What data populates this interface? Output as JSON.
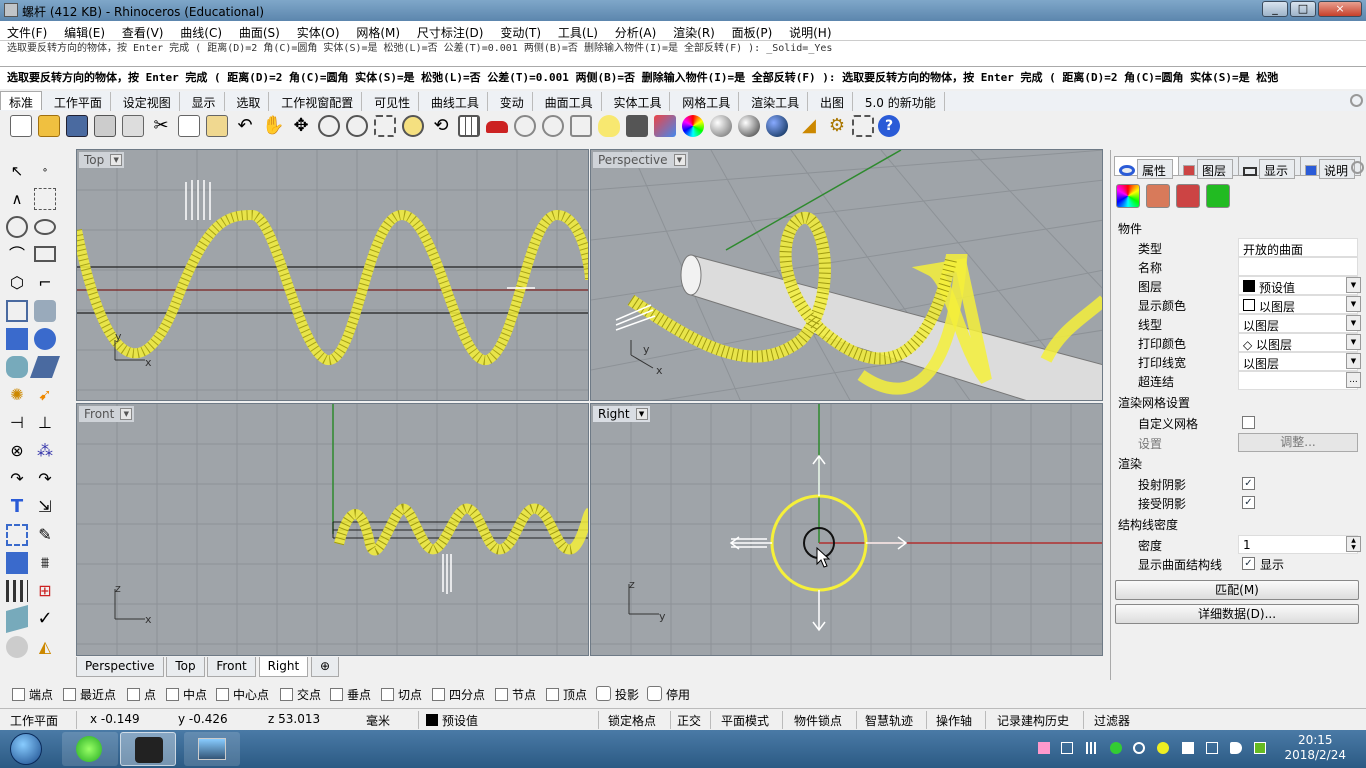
{
  "window": {
    "title": "螺杆 (412 KB) - Rhinoceros (Educational)",
    "minimize": "_",
    "maximize": "□",
    "close": "×"
  },
  "menu": [
    "文件(F)",
    "编辑(E)",
    "查看(V)",
    "曲线(C)",
    "曲面(S)",
    "实体(O)",
    "网格(M)",
    "尺寸标注(D)",
    "变动(T)",
    "工具(L)",
    "分析(A)",
    "渲染(R)",
    "面板(P)",
    "说明(H)"
  ],
  "command_history": "选取要反转方向的物体，按 Enter 完成 ( 距离(D)=2 角(C)=圆角 实体(S)=是 松弛(L)=否 公差(T)=0.001 两侧(B)=否 删除输入物件(I)=是 全部反转(F) ): _Solid=_Yes",
  "command_prompt": "选取要反转方向的物体，按 Enter 完成 ( 距离(D)=2 角(C)=圆角 实体(S)=是 松弛(L)=否 公差(T)=0.001 两侧(B)=否 删除输入物件(I)=是 全部反转(F) ):  选取要反转方向的物体，按 Enter 完成 ( 距离(D)=2 角(C)=圆角 实体(S)=是 松弛",
  "toolbar_tabs": [
    "标准",
    "工作平面",
    "设定视图",
    "显示",
    "选取",
    "工作视窗配置",
    "可见性",
    "曲线工具",
    "变动",
    "曲面工具",
    "实体工具",
    "网格工具",
    "渲染工具",
    "出图",
    "5.0 的新功能"
  ],
  "viewports": {
    "top": {
      "label": "Top",
      "axis_x": "x",
      "axis_y": "y"
    },
    "perspective": {
      "label": "Perspective",
      "axis_x": "x",
      "axis_y": "y"
    },
    "front": {
      "label": "Front",
      "axis_x": "x",
      "axis_y": "z"
    },
    "right": {
      "label": "Right",
      "axis_x": "y",
      "axis_y": "z"
    }
  },
  "viewport_tabs": [
    "Perspective",
    "Top",
    "Front",
    "Right",
    "⊕"
  ],
  "osnaps": [
    "端点",
    "最近点",
    "点",
    "中点",
    "中心点",
    "交点",
    "垂点",
    "切点",
    "四分点",
    "节点",
    "顶点",
    "投影",
    "停用"
  ],
  "status": {
    "cplane": "工作平面",
    "x": "x -0.149",
    "y": "y -0.426",
    "z": "z 53.013",
    "unit": "毫米",
    "layer": "预设值",
    "buttons": [
      "锁定格点",
      "正交",
      "平面模式",
      "物件锁点",
      "智慧轨迹",
      "操作轴",
      "记录建构历史",
      "过滤器"
    ]
  },
  "panel": {
    "tabs": [
      "属性",
      "图层",
      "显示",
      "说明"
    ],
    "section_object": "物件",
    "rows": [
      {
        "key": "类型",
        "value": "开放的曲面",
        "dropdown": false
      },
      {
        "key": "名称",
        "value": "",
        "dropdown": false
      },
      {
        "key": "图层",
        "value": "预设值",
        "dropdown": true
      },
      {
        "key": "显示颜色",
        "value": "以图层",
        "dropdown": true
      },
      {
        "key": "线型",
        "value": "以图层",
        "dropdown": true
      },
      {
        "key": "打印颜色",
        "value": "◇ 以图层",
        "dropdown": true
      },
      {
        "key": "打印线宽",
        "value": "以图层",
        "dropdown": true
      },
      {
        "key": "超连结",
        "value": "",
        "dropdown": false
      }
    ],
    "section_mesh": "渲染网格设置",
    "custom_mesh": "自定义网格",
    "settings": "设置",
    "adjust": "调整...",
    "section_render": "渲染",
    "cast_shadows": "投射阴影",
    "receive_shadows": "接受阴影",
    "section_isocurve": "结构线密度",
    "density": "密度",
    "density_value": "1",
    "show_isocurves": "显示曲面结构线",
    "show": "显示",
    "match": "匹配(M)",
    "details": "详细数据(D)..."
  },
  "clock": {
    "time": "20:15",
    "date": "2018/2/24"
  },
  "colors": {
    "helix": "#f5f03a",
    "viewport_bg": "#9fa4a9",
    "accent": "#2b5a84"
  }
}
